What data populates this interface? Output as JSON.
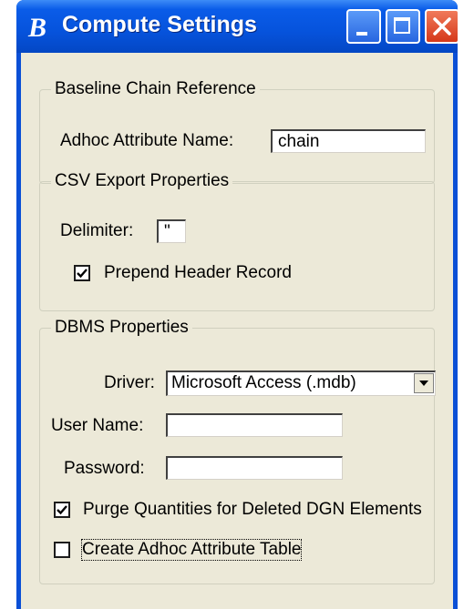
{
  "window": {
    "title": "Compute Settings",
    "app_icon": "bentley-b-icon",
    "controls": [
      "minimize-icon",
      "maximize-icon",
      "close-icon"
    ]
  },
  "baseline": {
    "legend": "Baseline Chain Reference",
    "adhoc_label": "Adhoc Attribute Name:",
    "adhoc_value": "chain"
  },
  "csv": {
    "legend": "CSV Export Properties",
    "delimiter_label": "Delimiter:",
    "delimiter_value": "\"",
    "prepend_label": "Prepend Header Record",
    "prepend_checked": true
  },
  "dbms": {
    "legend": "DBMS Properties",
    "driver_label": "Driver:",
    "driver_value": "Microsoft Access (.mdb)",
    "username_label": "User Name:",
    "username_value": "",
    "password_label": "Password:",
    "password_value": "",
    "purge_label": "Purge Quantities for Deleted DGN Elements",
    "purge_checked": true,
    "create_label": "Create Adhoc Attribute Table",
    "create_checked": false
  },
  "colors": {
    "titlebar": "#0653dc",
    "dialog_bg": "#ece9d8",
    "close_button": "#d5381a"
  }
}
